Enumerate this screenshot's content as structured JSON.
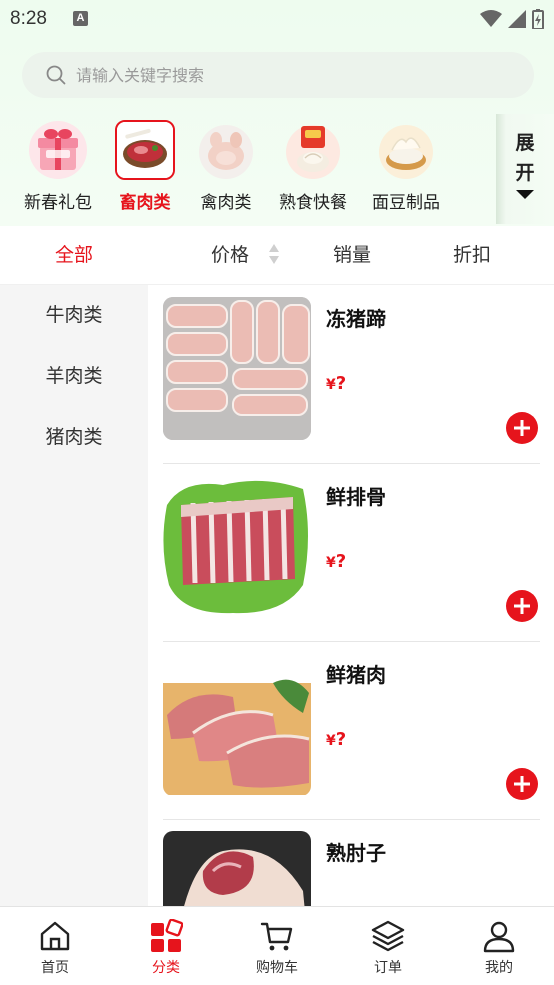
{
  "status_bar": {
    "time": "8:28",
    "notification_glyph": "A"
  },
  "search": {
    "placeholder": "请输入关键字搜索"
  },
  "categories": [
    {
      "label": "新春礼包",
      "icon": "gift-box-image"
    },
    {
      "label": "畜肉类",
      "icon": "steak-image",
      "active": true
    },
    {
      "label": "禽肉类",
      "icon": "chicken-image"
    },
    {
      "label": "熟食快餐",
      "icon": "dumpling-image"
    },
    {
      "label": "面豆制品",
      "icon": "noodle-image"
    }
  ],
  "expand": {
    "line1": "展",
    "line2": "开"
  },
  "sort_tabs": [
    {
      "label": "全部",
      "active": true
    },
    {
      "label": "价格"
    },
    {
      "label": "销量"
    },
    {
      "label": "折扣"
    }
  ],
  "sidebar": {
    "items": [
      "牛肉类",
      "羊肉类",
      "猪肉类"
    ]
  },
  "products": [
    {
      "name": "冻猪蹄",
      "currency": "¥",
      "price": "?"
    },
    {
      "name": "鲜排骨",
      "currency": "¥",
      "price": "?"
    },
    {
      "name": "鲜猪肉",
      "currency": "¥",
      "price": "?"
    },
    {
      "name": "熟肘子",
      "currency": "¥",
      "price": "?"
    }
  ],
  "bottom_nav": [
    {
      "label": "首页",
      "icon": "home-icon"
    },
    {
      "label": "分类",
      "icon": "category-icon",
      "active": true
    },
    {
      "label": "购物车",
      "icon": "cart-icon"
    },
    {
      "label": "订单",
      "icon": "layers-icon"
    },
    {
      "label": "我的",
      "icon": "user-icon"
    }
  ],
  "colors": {
    "accent": "#e6141c",
    "header_bg": "#eefcef",
    "sidebar_bg": "#f5f5f5"
  }
}
